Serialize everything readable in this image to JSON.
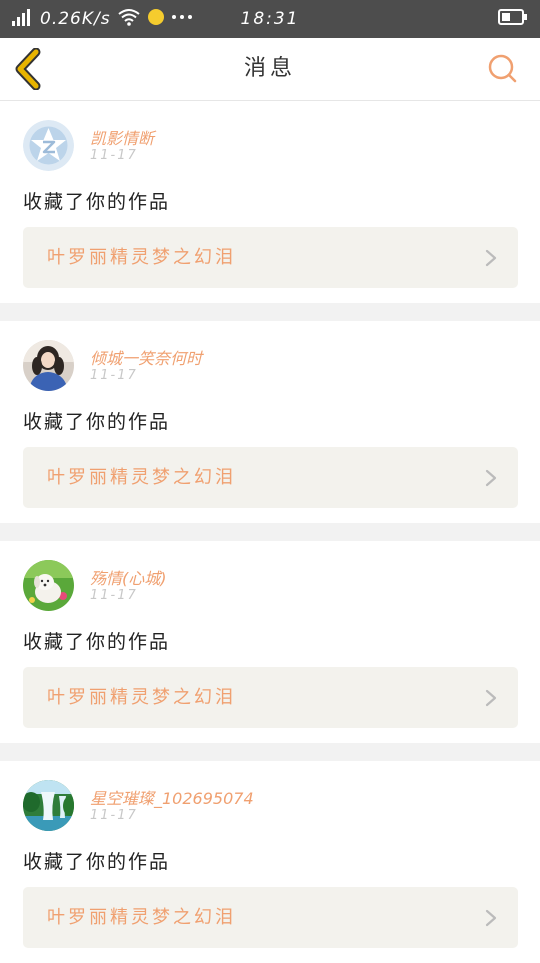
{
  "status_bar": {
    "net_speed": "0.26K/s",
    "time": "18:31",
    "icons": [
      "signal-icon",
      "wifi-icon",
      "notification-dot-icon",
      "more-dots-icon",
      "battery-icon"
    ]
  },
  "header": {
    "title": "消息",
    "back_icon": "chevron-left-icon",
    "search_icon": "search-icon"
  },
  "colors": {
    "accent": "#f0a070",
    "back_icon": "#e8b400",
    "status_bar_bg": "#4d4d4d",
    "link_bg": "#f3f2ed"
  },
  "messages": [
    {
      "username": "凯影情断",
      "date": "11-17",
      "action": "收藏了你的作品",
      "work_title": "叶罗丽精灵梦之幻泪",
      "avatar": "qzone-logo-avatar"
    },
    {
      "username": "倾城一笑奈何时",
      "date": "11-17",
      "action": "收藏了你的作品",
      "work_title": "叶罗丽精灵梦之幻泪",
      "avatar": "girl-photo-avatar"
    },
    {
      "username": "殇情(心城)",
      "date": "11-17",
      "action": "收藏了你的作品",
      "work_title": "叶罗丽精灵梦之幻泪",
      "avatar": "white-dog-photo-avatar"
    },
    {
      "username": "星空璀璨_102695074",
      "date": "11-17",
      "action": "收藏了你的作品",
      "work_title": "叶罗丽精灵梦之幻泪",
      "avatar": "waterfall-photo-avatar"
    }
  ]
}
